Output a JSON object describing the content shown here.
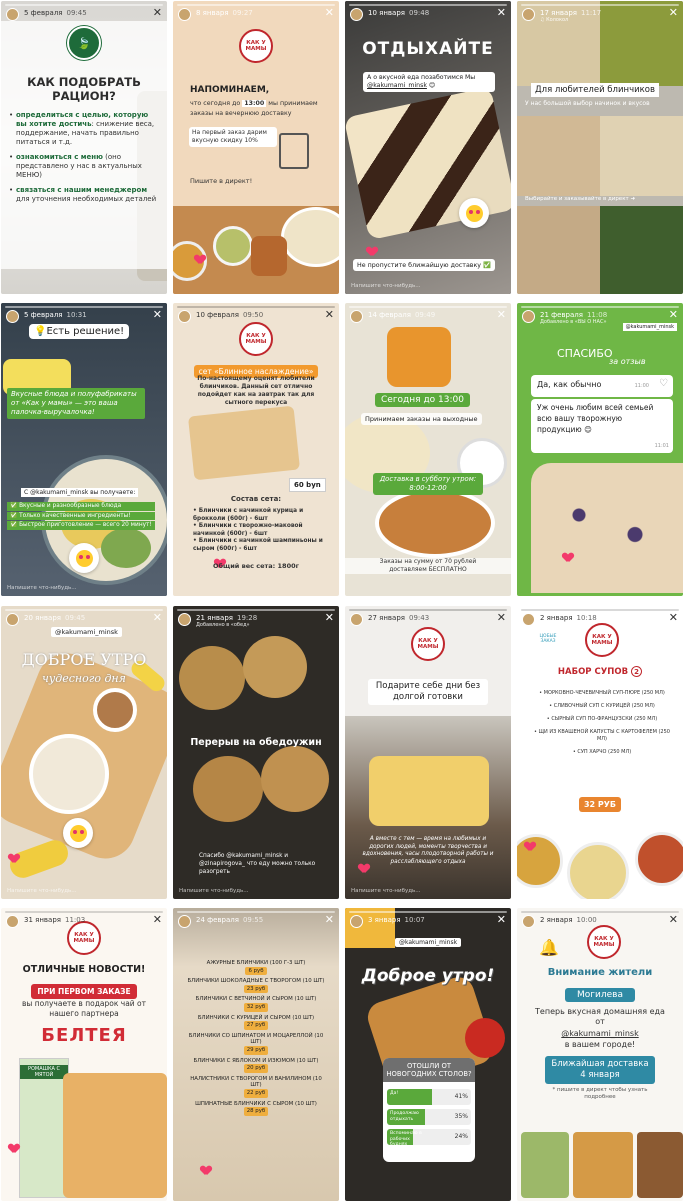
{
  "stories": [
    {
      "date": "5 февраля",
      "time": "09:45",
      "title": "КАК ПОДОБРАТЬ РАЦИОН?",
      "bullets": [
        {
          "strong": "определиться с целью, которую вы хотите достичь",
          "rest": ": снижение веса, поддержание, начать правильно питаться и т.д."
        },
        {
          "strong": "ознакомиться с меню",
          "rest": " (оно представлено у нас в актуальных МЕНЮ)"
        },
        {
          "strong": "связаться с нашим менеджером",
          "rest": " для уточнения необходимых деталей"
        }
      ]
    },
    {
      "date": "8 января",
      "time": "09:27",
      "logo": "КАК У МАМЫ",
      "title": "НАПОМИНАЕМ,",
      "line1": "что сегодня до",
      "hl": "13:00",
      "line2": "мы принимаем заказы на вечернюю доставку",
      "promo": "На первый заказ дарим вкусную скидку 10%",
      "cta": "Пишите в директ!"
    },
    {
      "date": "10 января",
      "time": "09:48",
      "title": "ОТДЫХАЙТЕ",
      "sub": "А о вкусной еда позаботимся Мы",
      "mention": "@kakumami_minsk",
      "bottom": "Не пропустите ближайшую доставку ✅",
      "footer": "Напишите что-нибудь..."
    },
    {
      "date": "17 января",
      "time": "11:17",
      "song": "Колокол",
      "title": "Для любителей блинчиков",
      "sub": "У нас большой выбор начинок и вкусов",
      "cta": "Выбирайте и заказывайте в директ"
    },
    {
      "date": "5 февраля",
      "time": "10:31",
      "title": "Есть решение!",
      "txt1": "Вкусные блюда и полуфабрикаты от «Как у мамы» — это ваша палочка-выручалочка!",
      "get": "С @kakumami_minsk вы получаете:",
      "checks": [
        "Вкусные и разнообразные блюда",
        "Только качественные ингредиенты!",
        "Быстрое приготовление — всего 20 минут!"
      ],
      "footer": "Напишите что-нибудь..."
    },
    {
      "date": "10 февраля",
      "time": "09:50",
      "logo": "КАК У МАМЫ",
      "set": "сет «Блинное наслаждение»",
      "desc": "По-настоящему оценят любители блинчиков. Данный сет отлично подойдет как на завтрак так для сытного перекуса",
      "price": "60 byn",
      "comp_title": "Состав сета:",
      "comp": [
        "Блинчики с начинкой курица и брокколи (600г) - 6шт",
        "Блинчики с творожно-маковой начинкой (600г) - 6шт",
        "Блинчики с начинкой шампиньоны и сыром (600г) - 6шт"
      ],
      "total": "Общий вес сета: 1800г"
    },
    {
      "date": "14 февраля",
      "time": "09:49",
      "tag1": "Сегодня до 13:00",
      "tag2": "Принимаем заказы на выходные",
      "tag3": "Доставка в субботу утром: 8:00-12:00",
      "bottom": "Заказы на сумму от 70 рублей доставляем БЕСПЛАТНО"
    },
    {
      "date": "21 февраля",
      "time": "11:08",
      "added": "Добавлено в «ВЫ О НАС»",
      "mention": "@kakumami_minsk",
      "thanks": "СПАСИБО",
      "thanks2": "за отзыв",
      "msg1": "Да, как обычно",
      "t1": "11:00",
      "msg2": "Уж очень любим всей семьей всю вашу творожную продукцию",
      "t2": "11:01"
    },
    {
      "date": "20 января",
      "time": "09:45",
      "mention": "@kakumami_minsk",
      "title": "ДОБРОЕ УТРО",
      "sub": "чудесного дня",
      "footer": "Напишите что-нибудь..."
    },
    {
      "date": "21 января",
      "time": "19:28",
      "added": "Добавлено в «обед»",
      "title": "Перерыв на обедоужин",
      "credit": "Спасибо @kakumami_minsk и @zinapirogova_ что еду можно только разогреть",
      "footer": "Напишите что-нибудь..."
    },
    {
      "date": "27 января",
      "time": "09:43",
      "logo": "КАК У МАМЫ",
      "title": "Подарите себе дни без долгой готовки",
      "text": "А вместе с тем — время на любимых и дорогих людей, моменты творчества и вдохновения, часы плодотворной работы и расслабляющего отдыха",
      "footer": "Напишите что-нибудь..."
    },
    {
      "date": "2 января",
      "time": "10:18",
      "logo": "КАК У МАМЫ",
      "small": "ЦОБЫЕ ЗАКАЗ",
      "title": "НАБОР СУПОВ",
      "num": "2",
      "items": [
        "МОРКОВНО-ЧЕЧЕВИЧНЫЙ СУП-ПЮРЕ (250 МЛ)",
        "СЛИВОЧНЫЙ СУП С КУРИЦЕЙ (250 МЛ)",
        "СЫРНЫЙ СУП ПО-ФРАНЦУЗСКИ (250 МЛ)",
        "ЩИ ИЗ КВАШЕНОЙ КАПУСТЫ С КАРТОФЕЛЕМ (250 МЛ)",
        "СУП ХАРЧО (250 МЛ)"
      ],
      "price": "32 РУБ"
    },
    {
      "date": "31 января",
      "time": "11:03",
      "logo": "КАК У МАМЫ",
      "title": "ОТЛИЧНЫЕ НОВОСТИ!",
      "badge": "ПРИ ПЕРВОМ ЗАКАЗЕ",
      "text": "вы получаете в подарок чай от нашего партнера",
      "brand": "БЕЛТЕЯ",
      "pack": "РОМАШКА С МЯТОЙ"
    },
    {
      "date": "24 февраля",
      "time": "09:55",
      "rows": [
        {
          "n": "АЖУРНЫЕ БЛИНЧИКИ (100 Г-3 ШТ)",
          "p": "6 руб"
        },
        {
          "n": "БЛИНЧИКИ ШОКОЛАДНЫЕ С ТВОРОГОМ (10 ШТ)",
          "p": "23 руб"
        },
        {
          "n": "БЛИНЧИКИ С ВЕТЧИНОЙ И СЫРОМ (10 ШТ)",
          "p": "32 руб"
        },
        {
          "n": "БЛИНЧИКИ С КУРИЦЕЙ И СЫРОМ (10 ШТ)",
          "p": "27 руб"
        },
        {
          "n": "БЛИНЧИКИ СО ШПИНАТОМ И МОЦАРЕЛЛОЙ (10 ШТ)",
          "p": "29 руб"
        },
        {
          "n": "БЛИНЧИКИ С ЯБЛОКОМ И ИЗЮМОМ (10 ШТ)",
          "p": "20 руб"
        },
        {
          "n": "НАЛИСТНИКИ С ТВОРОГОМ И ВАНИЛИНОМ (10 ШТ)",
          "p": "22 руб"
        },
        {
          "n": "ШПИНАТНЫЕ БЛИНЧИКИ С СЫРОМ (10 ШТ)",
          "p": "28 руб"
        }
      ]
    },
    {
      "date": "3 января",
      "time": "10:07",
      "mention": "@kakumami_minsk",
      "title": "Доброе утро!",
      "poll": "ОТОШЛИ ОТ НОВОГОДНИХ СТОЛОВ?",
      "opts": [
        {
          "t": "Да!",
          "p": "41%",
          "v": 41
        },
        {
          "t": "Продолжаю отдыхать",
          "p": "35%",
          "v": 35
        },
        {
          "t": "Вспоминаю в рабочих буднях",
          "p": "24%",
          "v": 24
        }
      ]
    },
    {
      "date": "2 января",
      "time": "10:00",
      "logo": "КАК У МАМЫ",
      "title": "Внимание жители",
      "city": "Могилева",
      "text": "Теперь вкусная домашняя еда от",
      "mention": "@kakumami_minsk",
      "text2": "в вашем городе!",
      "badge": "Ближайшая доставка 4 января",
      "note": "* пишите в директ чтобы узнать подробнее"
    }
  ]
}
